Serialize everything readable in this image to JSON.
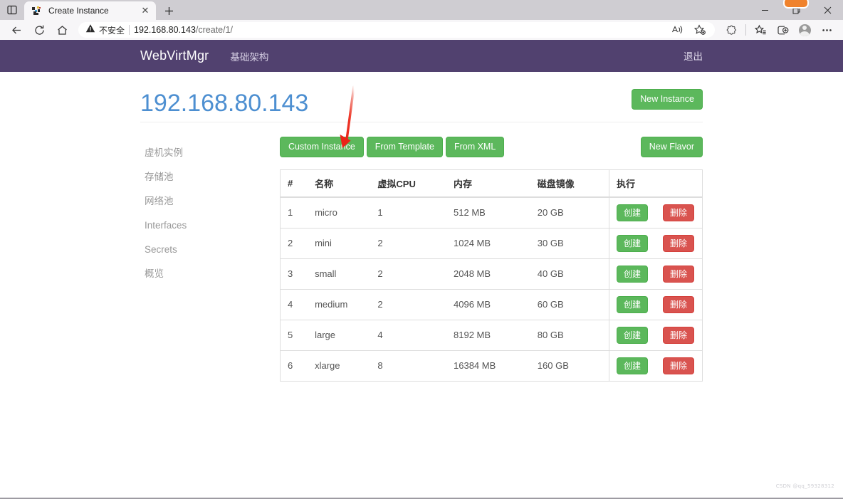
{
  "browser": {
    "tab": {
      "title": "Create Instance",
      "favicon_icon": "webvirtmgr-favicon",
      "close_icon": "close-icon"
    },
    "new_tab_label": "+",
    "tab_search_icon": "tab-actions-icon",
    "window_controls": {
      "minimize": "minimize-icon",
      "restore": "restore-icon",
      "close": "close-icon"
    },
    "nav": {
      "back_icon": "back-arrow-icon",
      "refresh_icon": "refresh-icon",
      "home_icon": "home-icon",
      "security_label": "不安全",
      "warning_icon": "warning-triangle-icon",
      "url_host": "192.168.80.143",
      "url_path": "/create/1/",
      "read_aloud_icon": "read-aloud-icon",
      "add_favorite_icon": "add-favorite-icon",
      "browser_essentials_icon": "browser-essentials-icon",
      "favorites_icon": "favorites-list-icon",
      "collections_icon": "collections-icon",
      "profile_icon": "profile-avatar-icon",
      "settings_icon": "settings-more-icon"
    }
  },
  "app": {
    "brand": "WebVirtMgr",
    "nav_items": [
      {
        "label": "基础架构"
      }
    ],
    "logout_label": "退出",
    "page_title": "192.168.80.143",
    "new_instance_label": "New Instance"
  },
  "sidebar": {
    "items": [
      {
        "label": "虚机实例"
      },
      {
        "label": "存储池"
      },
      {
        "label": "网络池"
      },
      {
        "label": "Interfaces"
      },
      {
        "label": "Secrets"
      },
      {
        "label": "概览"
      }
    ]
  },
  "toolbar": {
    "custom_instance_label": "Custom Instance",
    "from_template_label": "From Template",
    "from_xml_label": "From XML",
    "new_flavor_label": "New Flavor"
  },
  "table": {
    "headers": [
      "#",
      "名称",
      "虚拟CPU",
      "内存",
      "磁盘镜像",
      "执行"
    ],
    "action_labels": {
      "create": "创建",
      "delete": "删除"
    },
    "rows": [
      {
        "num": "1",
        "name": "micro",
        "vcpu": "1",
        "memory": "512 MB",
        "disk": "20 GB",
        "create": "创建",
        "delete": "删除"
      },
      {
        "num": "2",
        "name": "mini",
        "vcpu": "2",
        "memory": "1024 MB",
        "disk": "30 GB",
        "create": "创建",
        "delete": "删除"
      },
      {
        "num": "3",
        "name": "small",
        "vcpu": "2",
        "memory": "2048 MB",
        "disk": "40 GB",
        "create": "创建",
        "delete": "删除"
      },
      {
        "num": "4",
        "name": "medium",
        "vcpu": "2",
        "memory": "4096 MB",
        "disk": "60 GB",
        "create": "创建",
        "delete": "删除"
      },
      {
        "num": "5",
        "name": "large",
        "vcpu": "4",
        "memory": "8192 MB",
        "disk": "80 GB",
        "create": "创建",
        "delete": "删除"
      },
      {
        "num": "6",
        "name": "xlarge",
        "vcpu": "8",
        "memory": "16384 MB",
        "disk": "160 GB",
        "create": "创建",
        "delete": "删除"
      }
    ]
  },
  "annotation": {
    "arrow_icon": "red-arrow-annotation",
    "color": "#ee2b20"
  },
  "watermark": {
    "text": "CSDN @qq_59328312"
  },
  "colors": {
    "navbar_purple": "#51416f",
    "title_blue": "#4d8fd1",
    "btn_green": "#5cb85c",
    "btn_red": "#d9534f",
    "highlight_orange": "#f0822c"
  }
}
